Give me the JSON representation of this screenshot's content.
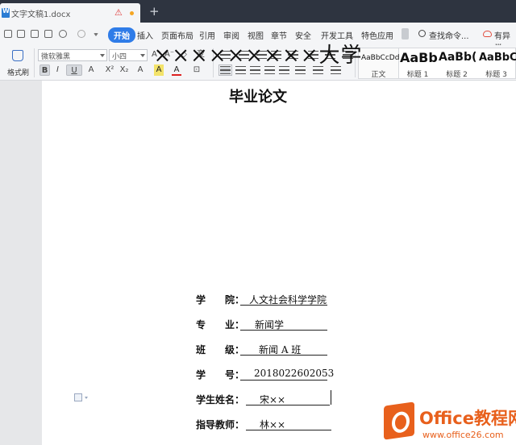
{
  "tab": {
    "title": "文字文稿1.docx",
    "warning_glyph": "⚠",
    "new_tab_glyph": "+"
  },
  "menu": {
    "items": [
      "开始",
      "插入",
      "页面布局",
      "引用",
      "审阅",
      "视图",
      "章节",
      "安全",
      "开发工具",
      "特色应用"
    ],
    "search_label": "查找命令...",
    "cloud_label": "有异常"
  },
  "ribbon": {
    "format_painter": "格式刷",
    "font_name": "微软雅黑",
    "font_size": "小四",
    "row1_left": [
      "A⁺",
      "A⁻",
      "◇",
      "变"
    ],
    "row2_left": [
      "B",
      "I",
      "U",
      "A",
      "X²",
      "X₂",
      "A",
      "A",
      "A",
      "⊡"
    ],
    "styles": [
      {
        "sample": "AaBbCcDd",
        "name": "正文"
      },
      {
        "sample": "AaBb",
        "name": "标题 1"
      },
      {
        "sample": "AaBb(",
        "name": "标题 2"
      },
      {
        "sample": "AaBbC",
        "name": "标题 3"
      }
    ]
  },
  "document": {
    "university": "×××××××××大学",
    "thesis_title": "毕业论文",
    "fields": [
      {
        "label": "学　　院：",
        "value": "人文社会科学学院"
      },
      {
        "label": "专　　业：",
        "value": "新闻学"
      },
      {
        "label": "班　　级：",
        "value": "新闻 A 班"
      },
      {
        "label": "学　　号：",
        "value": "2018022602053"
      },
      {
        "label": "学生姓名：",
        "value": "宋××"
      },
      {
        "label": "指导教师：",
        "value": "林××"
      }
    ]
  },
  "watermark": {
    "title": "Office教程网",
    "url": "www.office26.com"
  },
  "colors": {
    "accent": "#2f7ce8",
    "logo": "#e8601c",
    "tabbar": "#2e3440"
  }
}
